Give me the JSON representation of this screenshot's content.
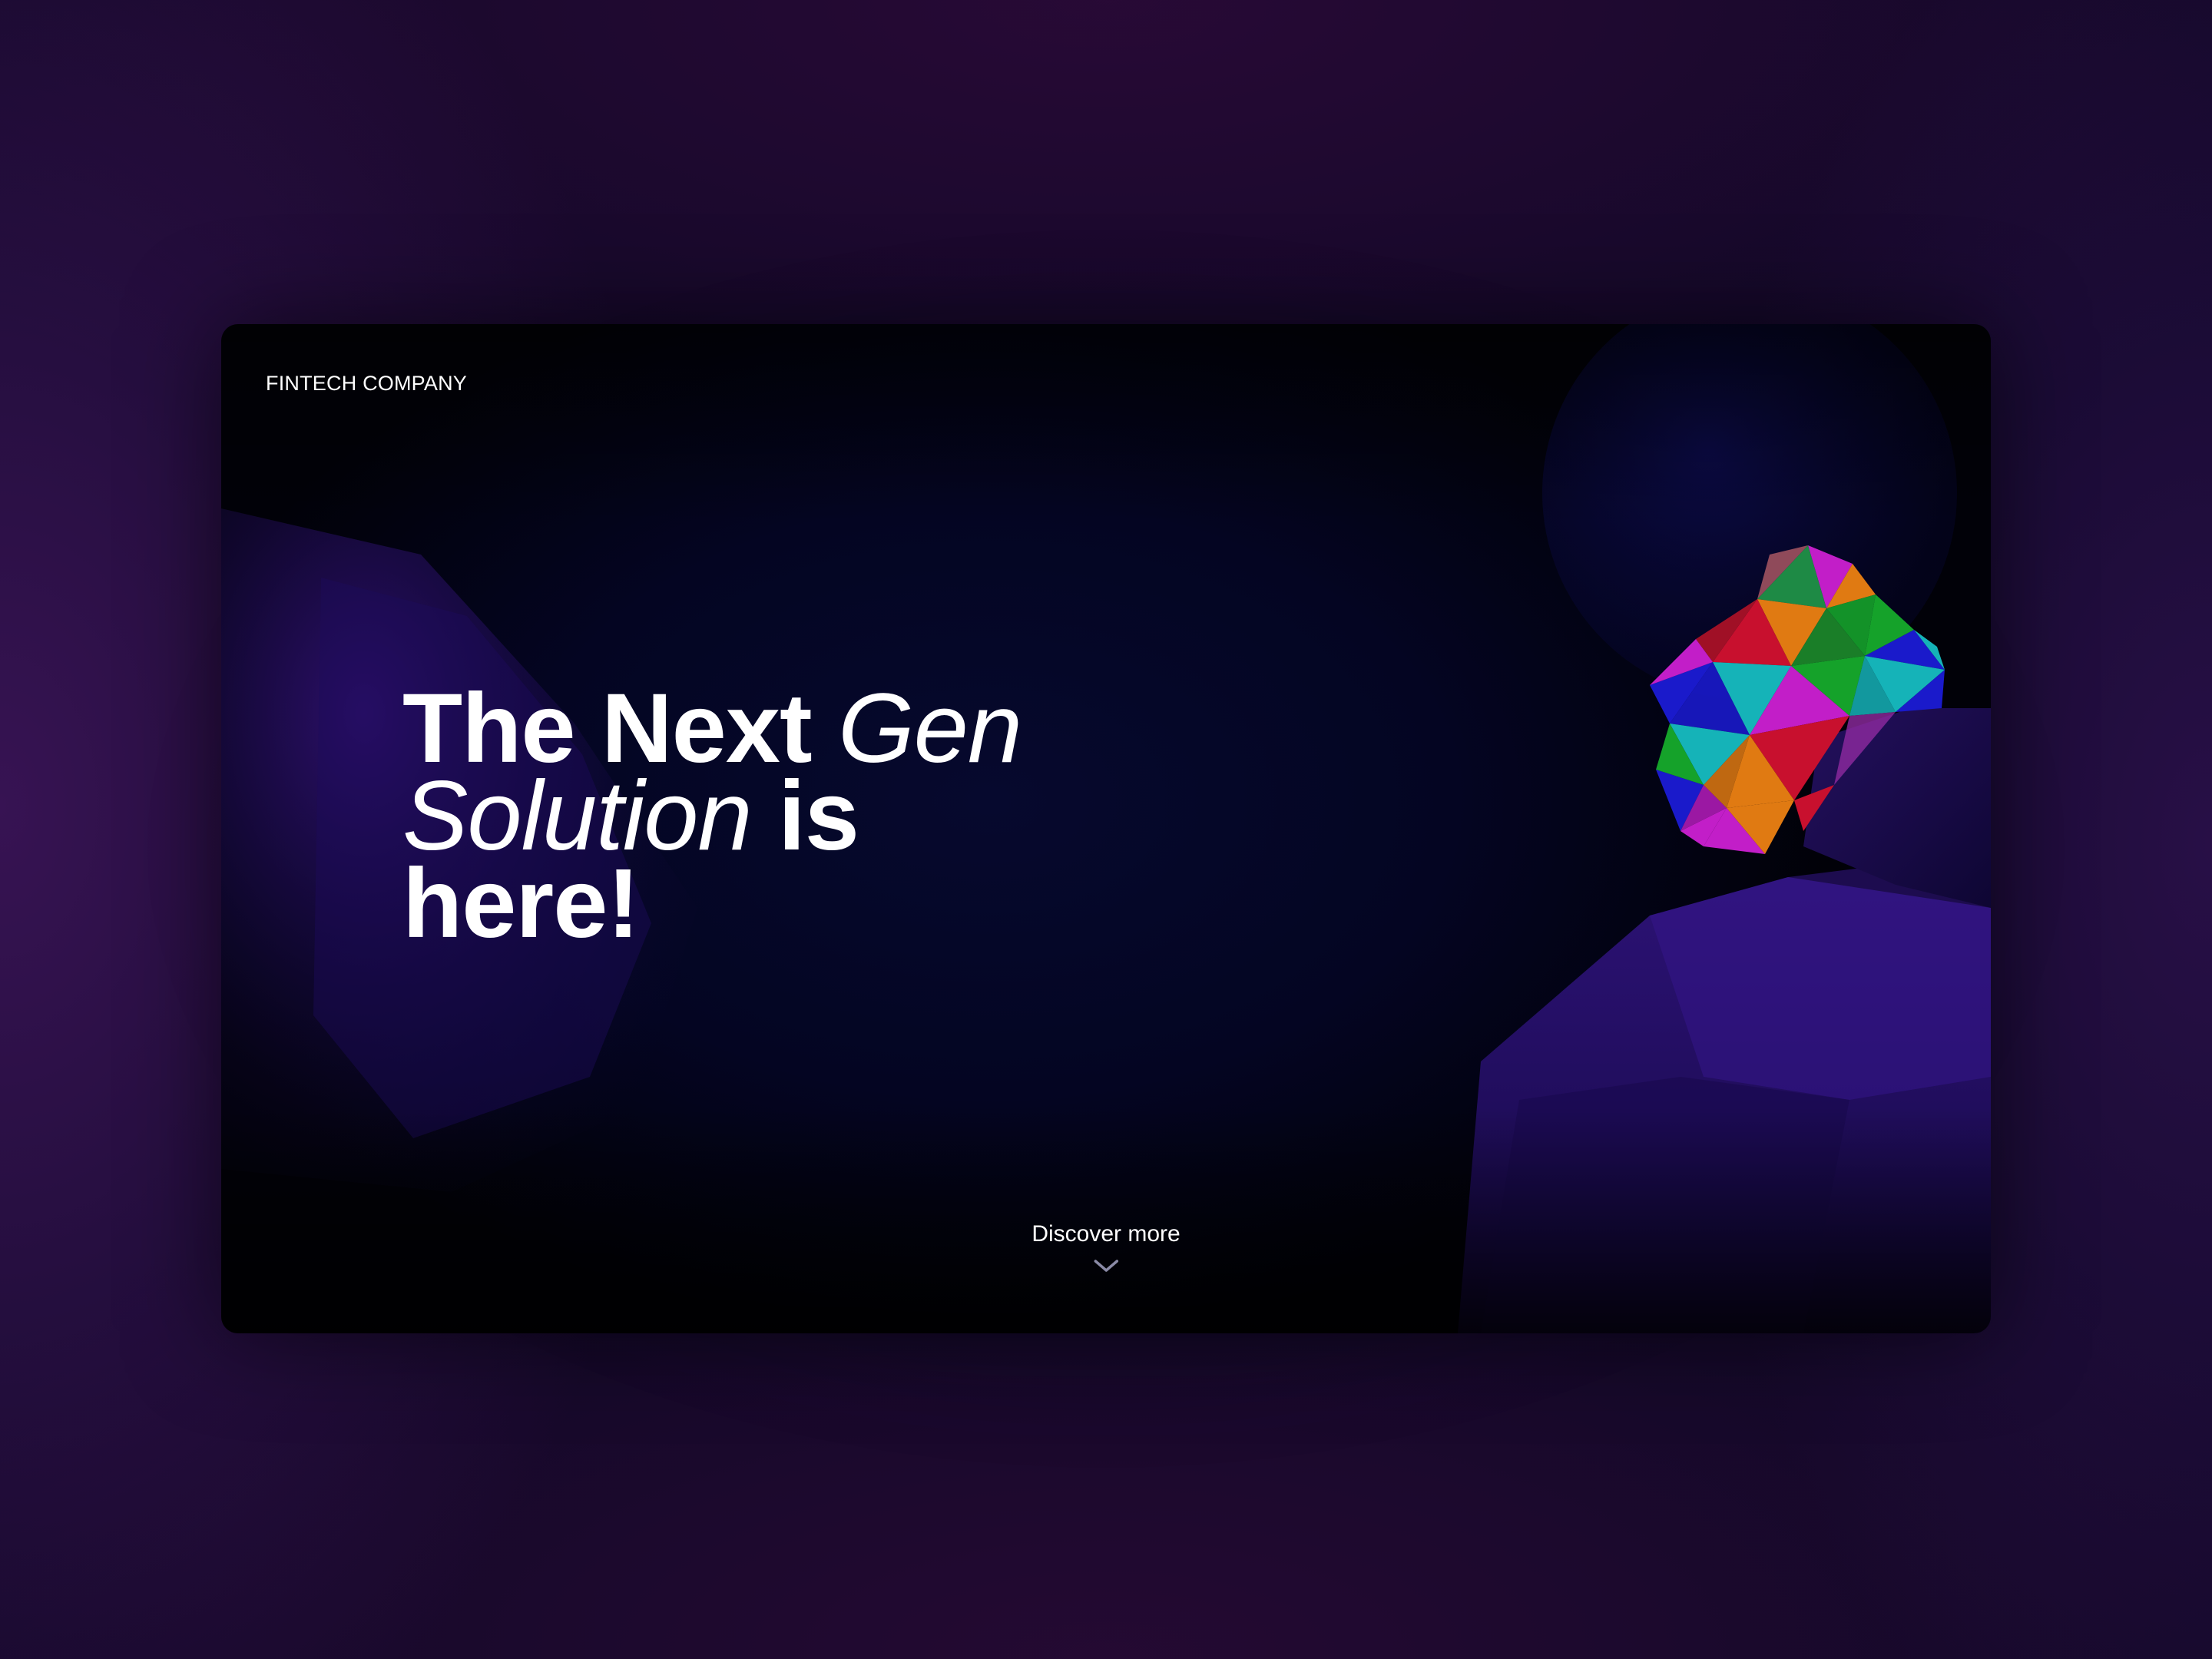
{
  "header": {
    "brand": "FINTECH COMPANY"
  },
  "hero": {
    "headline_part1": "The Next ",
    "headline_part2": "Gen Solution",
    "headline_part3": " is here!"
  },
  "discover": {
    "label": "Discover more",
    "icon": "chevron-down-icon"
  },
  "colors": {
    "page_background": "#0f0826",
    "card_background": "#040522",
    "text": "#ffffff",
    "rock_purple": "#2a0f6e",
    "gem_red": "#c8102e",
    "gem_green": "#15a22a",
    "gem_magenta": "#c21ec8",
    "gem_cyan": "#15b3b8",
    "gem_blue": "#1a1acb",
    "gem_orange": "#e07a12"
  }
}
